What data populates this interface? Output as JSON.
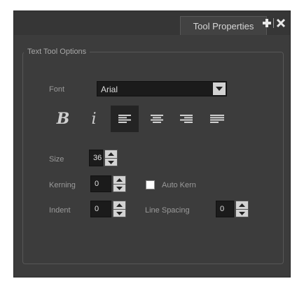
{
  "titlebar": {
    "tab_label": "Tool Properties",
    "icons": [
      "plus-icon",
      "divider",
      "close-icon"
    ]
  },
  "group": {
    "title": "Text Tool Options"
  },
  "font": {
    "label": "Font",
    "value": "Arial",
    "icon": "chevron-down-icon"
  },
  "format_buttons": [
    {
      "name": "bold",
      "glyph": "B",
      "active": false
    },
    {
      "name": "italic",
      "glyph": "i",
      "active": false
    },
    {
      "name": "align-left",
      "active": true
    },
    {
      "name": "align-center",
      "active": false
    },
    {
      "name": "align-right",
      "active": false
    },
    {
      "name": "justify",
      "active": false
    }
  ],
  "size": {
    "label": "Size",
    "value": "36"
  },
  "kerning": {
    "label": "Kerning",
    "value": "0"
  },
  "auto_kern": {
    "label": "Auto Kern",
    "checked": false
  },
  "indent": {
    "label": "Indent",
    "value": "0"
  },
  "line_spacing": {
    "label": "Line Spacing",
    "value": "0"
  },
  "colors": {
    "panel_bg": "#3c3c3c",
    "field_bg": "#1b1b1b",
    "label_text": "#9a9a9a",
    "active_button_bg": "#242424"
  }
}
